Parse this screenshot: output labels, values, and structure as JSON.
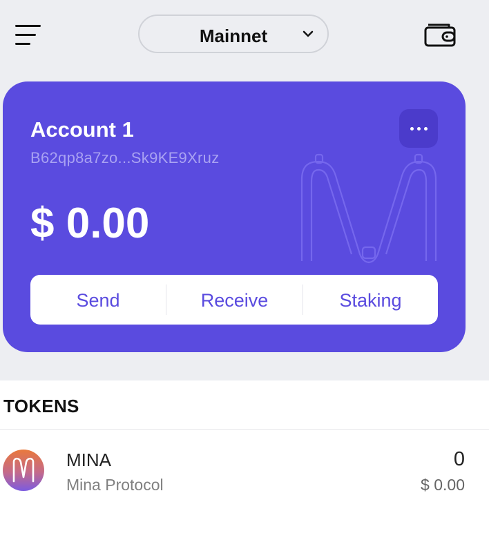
{
  "header": {
    "network_label": "Mainnet",
    "menu_icon": "hamburger-menu-icon",
    "wallet_icon": "wallet-icon",
    "chevron_icon": "chevron-down-icon"
  },
  "account": {
    "name": "Account 1",
    "address": "B62qp8a7zo...Sk9KE9Xruz",
    "balance": "$ 0.00",
    "more_icon": "ellipsis-icon"
  },
  "actions": {
    "send_label": "Send",
    "receive_label": "Receive",
    "staking_label": "Staking"
  },
  "tokens": {
    "header": "TOKENS",
    "items": [
      {
        "symbol": "MINA",
        "name": "Mina Protocol",
        "amount": "0",
        "value": "$ 0.00",
        "logo_icon": "mina-logo-icon"
      }
    ]
  },
  "colors": {
    "accent": "#5a4bdf",
    "background": "#edeef2"
  }
}
